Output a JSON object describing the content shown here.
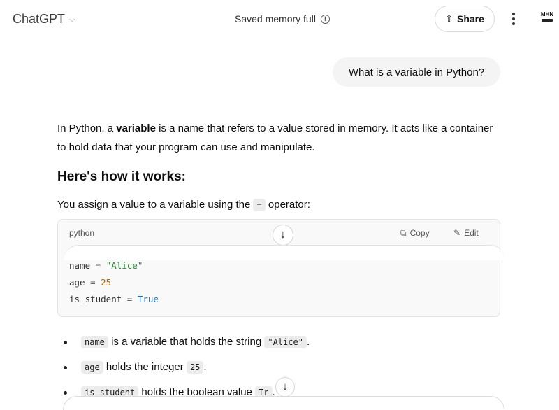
{
  "header": {
    "app_title": "ChatGPT",
    "chevron": "⌵",
    "memory_status": "Saved memory full",
    "info_icon": "i",
    "share_label": "Share",
    "share_icon": "⇧",
    "avatar_text": "MHN"
  },
  "user_message": "What is a variable in Python?",
  "answer": {
    "intro_before": "In Python, a ",
    "intro_bold": "variable",
    "intro_after": " is a name that refers to a value stored in memory. It acts like a container to hold data that your program can use and manipulate.",
    "heading": "Here's how it works:",
    "assign_before": "You assign a value to a variable using the ",
    "assign_code": "=",
    "assign_after": " operator:"
  },
  "code_block": {
    "language": "python",
    "copy_label": "Copy",
    "edit_label": "Edit",
    "copy_icon": "⧉",
    "edit_icon": "✎",
    "scroll_icon": "↓",
    "line1_var": "name",
    "line1_op": " = ",
    "line1_val": "\"Alice\"",
    "line2_var": "age",
    "line2_op": " = ",
    "line2_val": "25",
    "line3_var": "is_student",
    "line3_op": " = ",
    "line3_val": "True"
  },
  "bullets": [
    {
      "code": "name",
      "text": " is a variable that holds the string ",
      "code2": "\"Alice\"",
      "after": "."
    },
    {
      "code": "age",
      "text": " holds the integer ",
      "code2": "25",
      "after": "."
    },
    {
      "code": "is_student",
      "text": " holds the boolean value ",
      "code2": "Tr",
      "after": "."
    }
  ],
  "scroll_down_icon": "↓"
}
